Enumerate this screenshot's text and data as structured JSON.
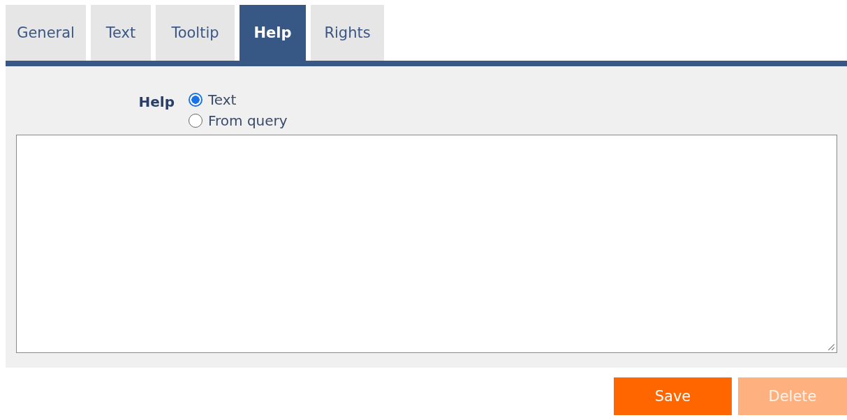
{
  "tabs": [
    {
      "label": "General",
      "selected": false
    },
    {
      "label": "Text",
      "selected": false
    },
    {
      "label": "Tooltip",
      "selected": false
    },
    {
      "label": "Help",
      "selected": true
    },
    {
      "label": "Rights",
      "selected": false
    }
  ],
  "help": {
    "label": "Help",
    "options": [
      {
        "label": "Text",
        "selected": true
      },
      {
        "label": "From query",
        "selected": false
      }
    ]
  },
  "buttons": [
    {
      "label": "Save",
      "disabled": false
    },
    {
      "label": "Delete",
      "disabled": true
    }
  ]
}
